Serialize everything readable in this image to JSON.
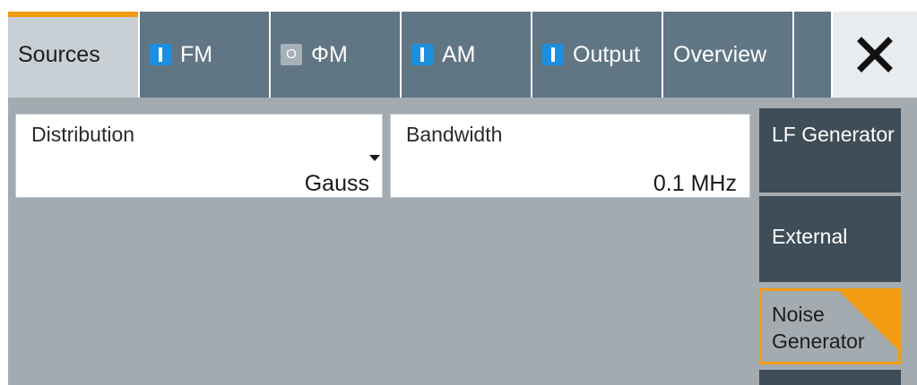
{
  "tabs": [
    {
      "label": "Sources",
      "indicator": "none",
      "active": true
    },
    {
      "label": "FM",
      "indicator": "on",
      "active": false
    },
    {
      "label": "ΦM",
      "indicator": "off",
      "active": false
    },
    {
      "label": "AM",
      "indicator": "on",
      "active": false
    },
    {
      "label": "Output",
      "indicator": "on",
      "active": false
    },
    {
      "label": "Overview",
      "indicator": "none",
      "active": false
    }
  ],
  "indicator_off_text": "O",
  "close_icon": "close-icon",
  "fields": {
    "distribution": {
      "label": "Distribution",
      "value": "Gauss"
    },
    "bandwidth": {
      "label": "Bandwidth",
      "value": "0.1 MHz"
    }
  },
  "side_buttons": [
    {
      "label": "LF Generator",
      "selected": false
    },
    {
      "label": "External",
      "selected": false
    },
    {
      "label": "Noise Generator",
      "selected": true
    }
  ],
  "colors": {
    "accent": "#f39c12",
    "tab": "#617685",
    "indicator_on": "#1c8fe0"
  }
}
